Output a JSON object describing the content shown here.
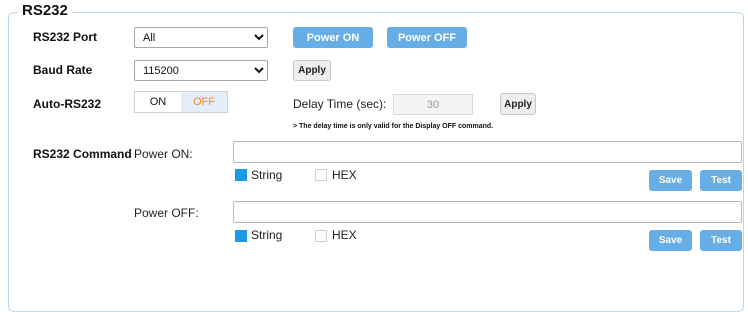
{
  "section": {
    "title": "RS232"
  },
  "port": {
    "label": "RS232 Port",
    "selected": "All",
    "power_on_label": "Power ON",
    "power_off_label": "Power OFF"
  },
  "baud": {
    "label": "Baud Rate",
    "selected": "115200",
    "apply_label": "Apply"
  },
  "auto": {
    "label": "Auto-RS232",
    "on_label": "ON",
    "off_label": "OFF",
    "active": "OFF",
    "delay_label": "Delay Time (sec):",
    "delay_value": "30",
    "apply_label": "Apply",
    "note": "> The delay time is only valid for the Display OFF command."
  },
  "command": {
    "label": "RS232 Command",
    "power_on": {
      "label": "Power ON:",
      "value": "",
      "string_label": "String",
      "hex_label": "HEX",
      "string_checked": true,
      "hex_checked": false,
      "save_label": "Save",
      "test_label": "Test"
    },
    "power_off": {
      "label": "Power OFF:",
      "value": "",
      "string_label": "String",
      "hex_label": "HEX",
      "string_checked": true,
      "hex_checked": false,
      "save_label": "Save",
      "test_label": "Test"
    }
  },
  "colors": {
    "accent": "#66aee5",
    "checkbox": "#1a9ae6",
    "toggle_off_text": "#f08a24",
    "border": "#b9d7ee"
  }
}
